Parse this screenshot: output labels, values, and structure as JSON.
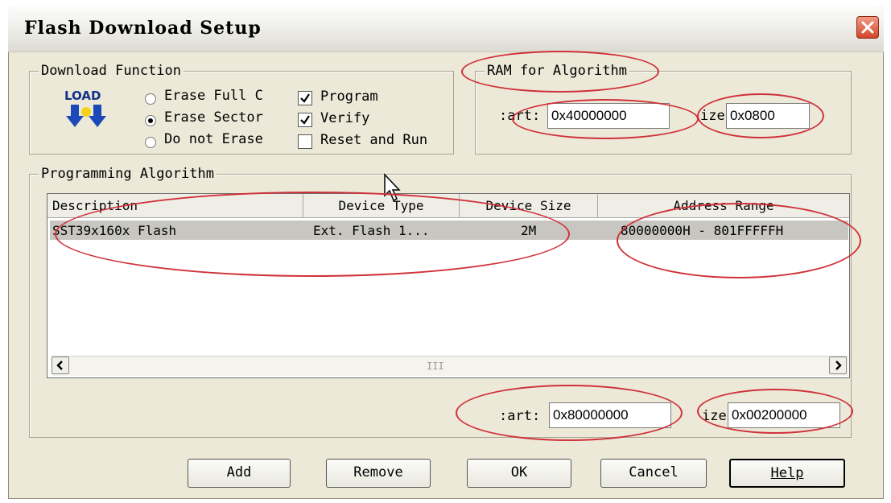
{
  "window": {
    "title": "Flash Download Setup"
  },
  "download_function": {
    "legend": "Download Function",
    "load_icon_text": "LOAD",
    "radios": [
      {
        "label": "Erase Full C",
        "selected": false
      },
      {
        "label": "Erase Sector",
        "selected": true
      },
      {
        "label": "Do not Erase",
        "selected": false
      }
    ],
    "checks": [
      {
        "label": "Program",
        "checked": true
      },
      {
        "label": "Verify",
        "checked": true
      },
      {
        "label": "Reset and Run",
        "checked": false
      }
    ]
  },
  "ram": {
    "legend": "RAM for Algorithm",
    "start_label": ":art:",
    "start_value": "0x40000000",
    "size_label": "ize:",
    "size_value": "0x0800"
  },
  "programming": {
    "legend": "Programming Algorithm",
    "columns": [
      "Description",
      "Device Type",
      "Device Size",
      "Address Range"
    ],
    "rows": [
      {
        "description": "SST39x160x Flash",
        "device_type": "Ext. Flash 1...",
        "device_size": "2M",
        "address_range": "80000000H - 801FFFFFH"
      }
    ],
    "scroll_grip": "III",
    "start_label": ":art:",
    "start_value": "0x80000000",
    "size_label": "ize:",
    "size_value": "0x00200000"
  },
  "buttons": {
    "add": "Add",
    "remove": "Remove",
    "ok": "OK",
    "cancel": "Cancel",
    "help": "Help"
  },
  "colors": {
    "annotation": "#d0313a",
    "dialog_bg": "#ece9d8",
    "close_button": "#d2452a"
  }
}
